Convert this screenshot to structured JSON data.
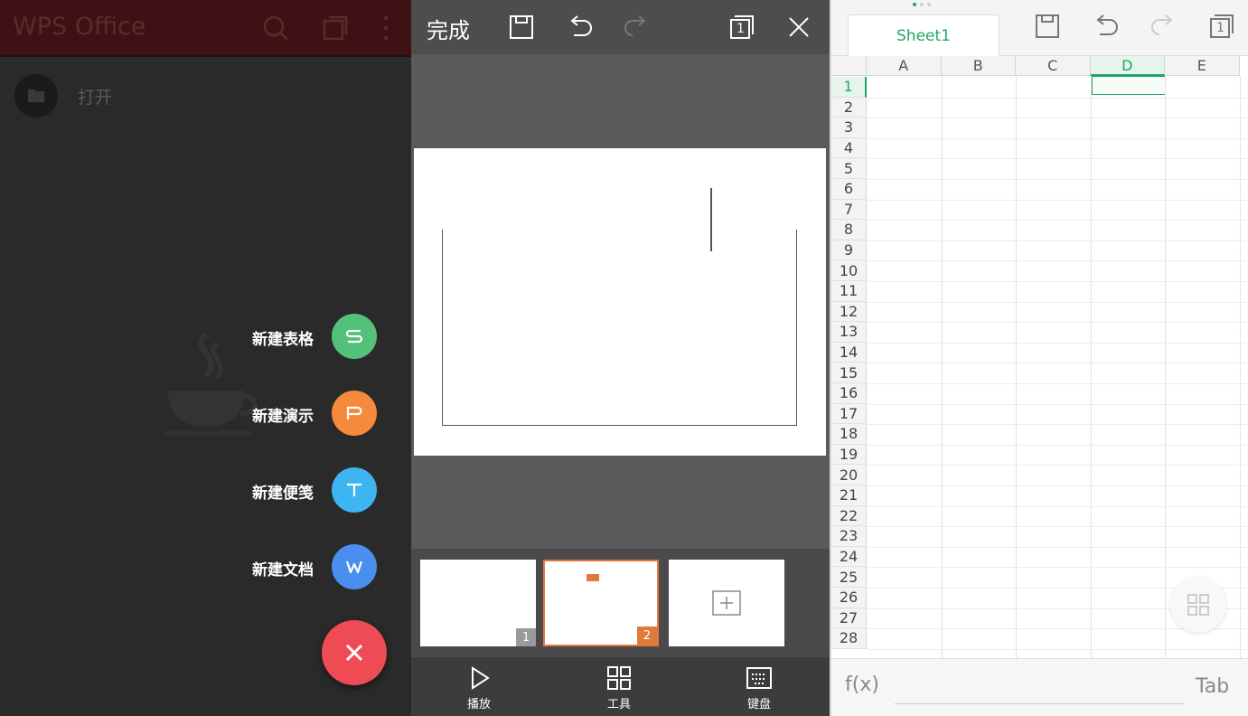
{
  "home": {
    "app_title": "WPS Office",
    "open_label": "打开",
    "fab_items": [
      {
        "label": "新建表格",
        "color": "#53c17a",
        "icon": "spreadsheet-s-icon"
      },
      {
        "label": "新建演示",
        "color": "#f68a3c",
        "icon": "presentation-p-icon"
      },
      {
        "label": "新建便笺",
        "color": "#3db5f0",
        "icon": "note-t-icon"
      },
      {
        "label": "新建文档",
        "color": "#4a8ff0",
        "icon": "document-w-icon"
      }
    ],
    "close_color": "#ef4b54"
  },
  "presentation": {
    "done_label": "完成",
    "window_count": "1",
    "thumbnails": [
      {
        "number": "1"
      },
      {
        "number": "2"
      }
    ],
    "toolbar": {
      "play_label": "播放",
      "tools_label": "工具",
      "keyboard_label": "键盘"
    },
    "accent_color": "#e07a3c"
  },
  "spreadsheet": {
    "sheet_tab": "Sheet1",
    "window_count": "1",
    "columns": [
      "A",
      "B",
      "C",
      "D",
      "E"
    ],
    "rows": [
      "1",
      "2",
      "3",
      "4",
      "5",
      "6",
      "7",
      "8",
      "9",
      "10",
      "11",
      "12",
      "13",
      "14",
      "15",
      "16",
      "17",
      "18",
      "19",
      "20",
      "21",
      "22",
      "23",
      "24",
      "25",
      "26",
      "27",
      "28"
    ],
    "selected_column": "D",
    "selected_row": "1",
    "fx_label": "f(x)",
    "tab_label": "Tab",
    "accent_color": "#21a366"
  }
}
